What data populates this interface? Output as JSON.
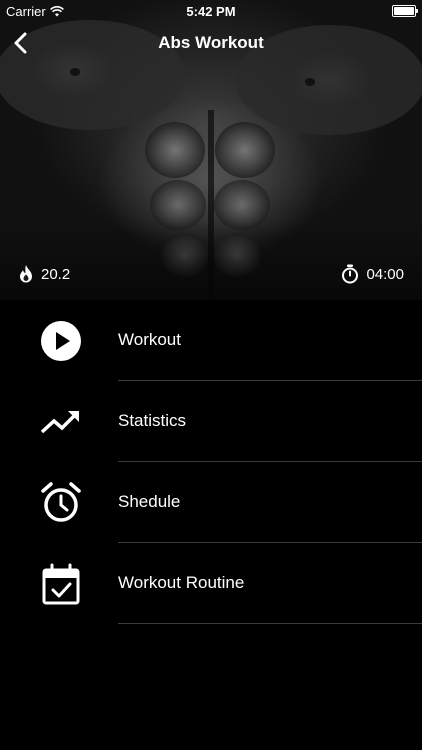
{
  "status_bar": {
    "carrier": "Carrier",
    "time": "5:42 PM"
  },
  "nav": {
    "back_icon": "chevron-left-icon",
    "title": "Abs Workout"
  },
  "hero": {
    "calories_icon": "flame-icon",
    "calories": "20.2",
    "duration_icon": "stopwatch-icon",
    "duration": "04:00"
  },
  "menu": {
    "items": [
      {
        "label": "Workout",
        "icon": "play-circle-icon"
      },
      {
        "label": "Statistics",
        "icon": "trending-up-icon"
      },
      {
        "label": "Shedule",
        "icon": "alarm-clock-icon"
      },
      {
        "label": "Workout Routine",
        "icon": "calendar-check-icon"
      }
    ]
  },
  "colors": {
    "background": "#000000",
    "text": "#ffffff",
    "divider": "#3a3a3a"
  }
}
